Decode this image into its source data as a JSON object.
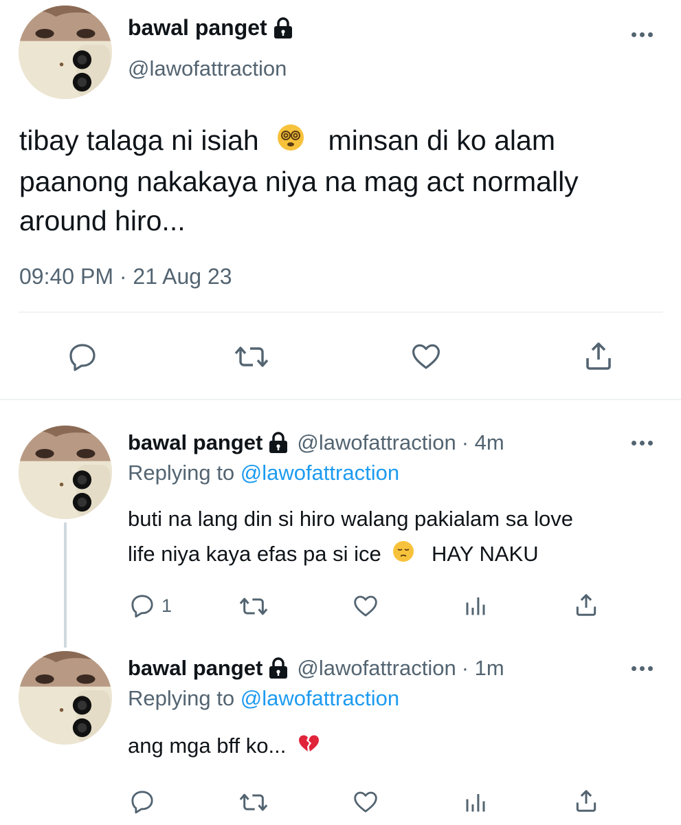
{
  "main_tweet": {
    "display_name": "bawal panget",
    "handle": "@lawofattraction",
    "text_line1_a": "tibay talaga ni isiah",
    "text_line1_b": "minsan di ko alam",
    "text_line2": "paanong nakakaya niya na mag act normally",
    "text_line3": "around hiro...",
    "timestamp": "09:40 PM · 21 Aug 23",
    "icons": [
      "lock-icon",
      "more-icon",
      "reply-icon",
      "retweet-icon",
      "like-icon",
      "share-icon"
    ]
  },
  "replies": [
    {
      "display_name": "bawal panget",
      "handle": "@lawofattraction",
      "time": "· 4m",
      "replying_prefix": "Replying to",
      "replying_to": "@lawofattraction",
      "text_line1": "buti na lang din si hiro walang pakialam sa love",
      "text_line2_a": "life niya kaya efas pa si ice",
      "text_line2_b": "HAY NAKU",
      "reply_count": "1"
    },
    {
      "display_name": "bawal panget",
      "handle": "@lawofattraction",
      "time": "· 1m",
      "replying_prefix": "Replying to",
      "replying_to": "@lawofattraction",
      "text_line1": "ang mga bff ko...",
      "reply_count": ""
    }
  ],
  "colors": {
    "text": "#0f1419",
    "muted": "#536471",
    "link": "#1d9bf0",
    "divider": "#eff3f4"
  }
}
